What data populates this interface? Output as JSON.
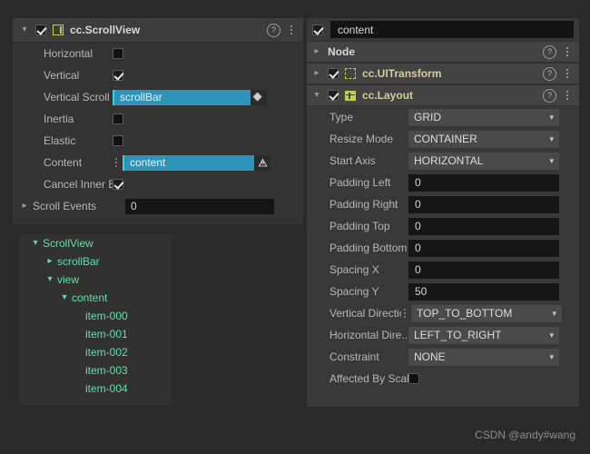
{
  "scrollview_panel": {
    "header": {
      "title": "cc.ScrollView",
      "enabled": true,
      "expanded": true,
      "help_icon": "question-circle-icon",
      "menu_icon": "vertical-dots-icon",
      "component_icon": "scrollview-icon"
    },
    "properties": [
      {
        "label": "Horizontal",
        "type": "checkbox",
        "checked": false
      },
      {
        "label": "Vertical",
        "type": "checkbox",
        "checked": true
      },
      {
        "label": "Vertical Scroll ...",
        "type": "ref-blue",
        "value": "scrollBar",
        "badge": "puzzle-piece-icon"
      },
      {
        "label": "Inertia",
        "type": "checkbox",
        "checked": false
      },
      {
        "label": "Elastic",
        "type": "checkbox",
        "checked": false
      },
      {
        "label": "Content",
        "type": "ref-blue",
        "value": "content",
        "badge": "node-triangle-icon",
        "drag_handle": true
      },
      {
        "label": "Cancel Inner E...",
        "type": "checkbox",
        "checked": true
      },
      {
        "label": "Scroll Events",
        "type": "number",
        "value": "0",
        "expandable": true
      }
    ]
  },
  "tree_panel": {
    "nodes": [
      {
        "label": "ScrollView",
        "depth": 0,
        "arrow": "down"
      },
      {
        "label": "scrollBar",
        "depth": 1,
        "arrow": "right"
      },
      {
        "label": "view",
        "depth": 1,
        "arrow": "down"
      },
      {
        "label": "content",
        "depth": 2,
        "arrow": "down"
      },
      {
        "label": "item-000",
        "depth": 4,
        "arrow": "none"
      },
      {
        "label": "item-001",
        "depth": 4,
        "arrow": "none"
      },
      {
        "label": "item-002",
        "depth": 4,
        "arrow": "none"
      },
      {
        "label": "item-003",
        "depth": 4,
        "arrow": "none"
      },
      {
        "label": "item-004",
        "depth": 4,
        "arrow": "none"
      }
    ]
  },
  "inspector": {
    "node_name": "content",
    "node_enabled": true,
    "sections": [
      {
        "title": "Node",
        "expanded": false,
        "has_checkbox": false,
        "icon": "none",
        "help_icon": "question-circle-icon",
        "menu_icon": "vertical-dots-icon"
      },
      {
        "title": "cc.UITransform",
        "expanded": false,
        "has_checkbox": true,
        "checked": true,
        "icon": "uitransform-icon",
        "help_icon": "question-circle-icon",
        "menu_icon": "vertical-dots-icon"
      },
      {
        "title": "cc.Layout",
        "expanded": true,
        "has_checkbox": true,
        "checked": true,
        "icon": "layout-icon",
        "help_icon": "question-circle-icon",
        "menu_icon": "vertical-dots-icon"
      }
    ],
    "layout_properties": [
      {
        "label": "Type",
        "type": "select",
        "value": "GRID"
      },
      {
        "label": "Resize Mode",
        "type": "select",
        "value": "CONTAINER"
      },
      {
        "label": "Start Axis",
        "type": "select",
        "value": "HORIZONTAL"
      },
      {
        "label": "Padding Left",
        "type": "number",
        "value": "0"
      },
      {
        "label": "Padding Right",
        "type": "number",
        "value": "0"
      },
      {
        "label": "Padding Top",
        "type": "number",
        "value": "0"
      },
      {
        "label": "Padding Bottom",
        "type": "number",
        "value": "0"
      },
      {
        "label": "Spacing X",
        "type": "number",
        "value": "0"
      },
      {
        "label": "Spacing Y",
        "type": "number",
        "value": "50"
      },
      {
        "label": "Vertical Direction",
        "type": "select",
        "value": "TOP_TO_BOTTOM",
        "drag_handle": true
      },
      {
        "label": "Horizontal Dire...",
        "type": "select",
        "value": "LEFT_TO_RIGHT"
      },
      {
        "label": "Constraint",
        "type": "select",
        "value": "NONE"
      },
      {
        "label": "Affected By Scale",
        "type": "checkbox",
        "checked": false
      }
    ]
  },
  "watermark": "CSDN @andy#wang",
  "colors": {
    "accent_blue": "#2e93b8",
    "tree_green": "#5fe0a8",
    "component_yellow": "#d3cf9a",
    "icon_yellow_green": "#c2cf4a",
    "panel_bg": "#333333",
    "inspector_bg": "#383838",
    "page_bg": "#2a2a2a"
  }
}
